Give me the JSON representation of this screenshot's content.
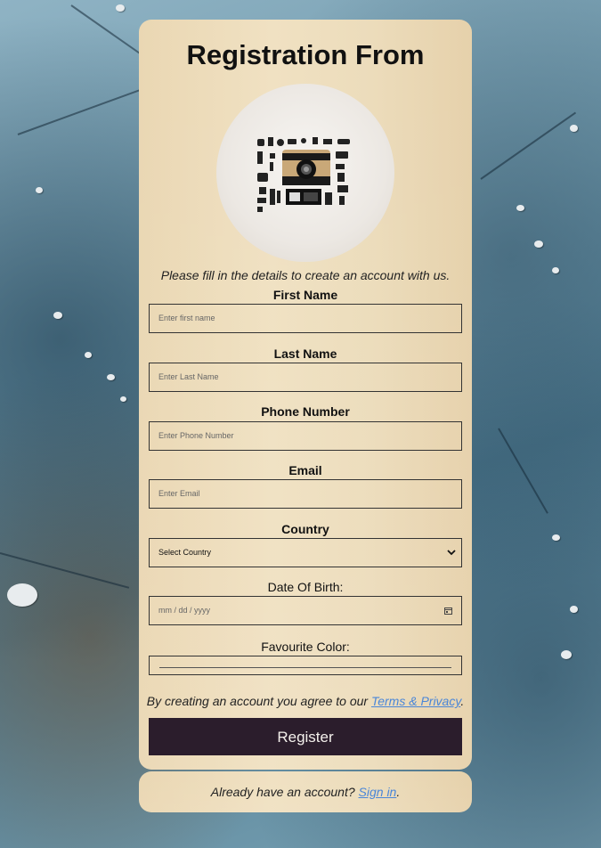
{
  "form": {
    "title": "Registration From",
    "subtitle": "Please fill in the details to create an account with us.",
    "first_name": {
      "label": "First Name",
      "placeholder": "Enter first name"
    },
    "last_name": {
      "label": "Last Name",
      "placeholder": "Enter Last Name"
    },
    "phone": {
      "label": "Phone Number",
      "placeholder": "Enter Phone Number"
    },
    "email": {
      "label": "Email",
      "placeholder": "Enter Email"
    },
    "country": {
      "label": "Country",
      "selected": "Select Country"
    },
    "dob": {
      "label": "Date Of Birth:",
      "placeholder": "mm / dd / yyyy"
    },
    "color": {
      "label": "Favourite Color:"
    },
    "agree_text": "By creating an account you agree to our ",
    "terms_link": "Terms & Privacy",
    "agree_end": ".",
    "register_label": "Register"
  },
  "signin": {
    "text": "Already have an account? ",
    "link": "Sign in",
    "end": "."
  },
  "icons": {
    "avatar": "camera-flatlay-image",
    "select": "chevron-down-icon",
    "date": "calendar-icon"
  },
  "colors": {
    "card": "#ecdcbb",
    "button": "#2b1d2c",
    "link": "#4a86d8"
  }
}
